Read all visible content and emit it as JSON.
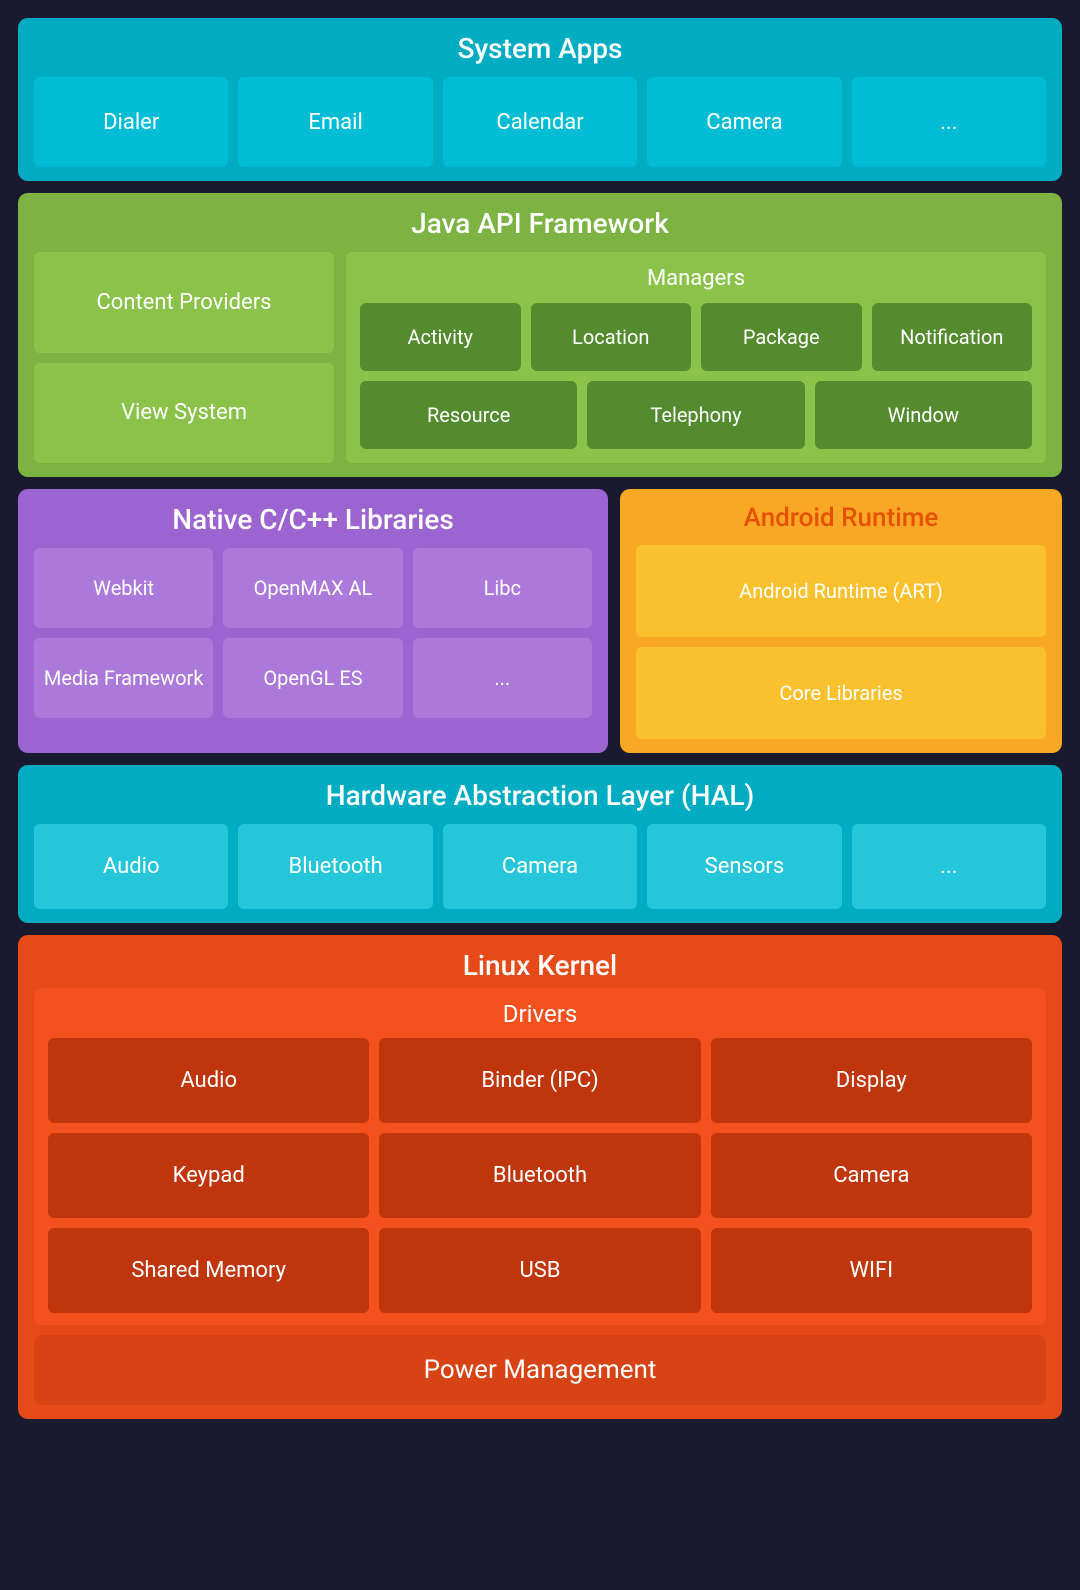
{
  "system_apps": {
    "title": "System Apps",
    "cards": [
      "Dialer",
      "Email",
      "Calendar",
      "Camera",
      "..."
    ]
  },
  "java_api": {
    "title": "Java API Framework",
    "left": {
      "items": [
        "Content Providers",
        "View System"
      ]
    },
    "right": {
      "title": "Managers",
      "rows": [
        [
          "Activity",
          "Location",
          "Package",
          "Notification"
        ],
        [
          "Resource",
          "Telephony",
          "Window"
        ]
      ]
    }
  },
  "native_libs": {
    "title": "Native C/C++ Libraries",
    "rows": [
      [
        "Webkit",
        "OpenMAX AL",
        "Libc"
      ],
      [
        "Media Framework",
        "OpenGL ES",
        "..."
      ]
    ]
  },
  "android_runtime": {
    "title": "Android Runtime",
    "cards": [
      "Android Runtime (ART)",
      "Core Libraries"
    ]
  },
  "hal": {
    "title": "Hardware Abstraction Layer (HAL)",
    "cards": [
      "Audio",
      "Bluetooth",
      "Camera",
      "Sensors",
      "..."
    ]
  },
  "linux_kernel": {
    "title": "Linux Kernel",
    "drivers": {
      "title": "Drivers",
      "rows": [
        [
          "Audio",
          "Binder (IPC)",
          "Display"
        ],
        [
          "Keypad",
          "Bluetooth",
          "Camera"
        ],
        [
          "Shared Memory",
          "USB",
          "WIFI"
        ]
      ]
    },
    "power_management": "Power Management"
  }
}
